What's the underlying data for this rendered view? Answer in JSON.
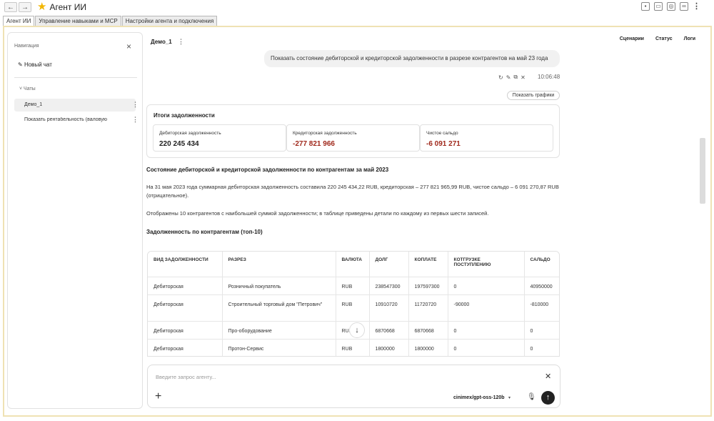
{
  "window": {
    "back_label": "←",
    "forward_label": "→",
    "title": "Агент ИИ",
    "tools": [
      "save-icon",
      "print-icon",
      "preview-icon",
      "link-icon",
      "more-icon"
    ]
  },
  "tabs": [
    {
      "label": "Агент ИИ",
      "active": true
    },
    {
      "label": "Управление навыками и MCP",
      "active": false
    },
    {
      "label": "Настройки агента и подключения",
      "active": false
    }
  ],
  "sidebar": {
    "title": "Навигация",
    "close": "×",
    "new_chat": "Новый чат",
    "chats_header": "Чаты",
    "chats": [
      {
        "label": "Демо_1",
        "selected": true
      },
      {
        "label": "Показать рентабельность (валовую",
        "selected": false
      }
    ]
  },
  "header": {
    "chat_name": "Демо_1",
    "links": [
      "Сценарии",
      "Статус",
      "Логи"
    ]
  },
  "user_message": {
    "text": "Показать состояние дебиторской и кредиторской задолженности в разрезе контрагентов на май 23 года",
    "time": "10:06:48"
  },
  "show_charts_label": "Показать графики",
  "summary": {
    "title": "Итоги задолженности",
    "kpis": [
      {
        "label": "Дебиторская задолженность",
        "value": "220 245 434",
        "negative": false
      },
      {
        "label": "Кредиторская задолженность",
        "value": "-277 821 966",
        "negative": true
      },
      {
        "label": "Чистое сальдо",
        "value": "-6 091 271",
        "negative": true
      }
    ]
  },
  "answer": {
    "heading": "Состояние дебиторской и кредиторской задолженности по контрагентам за май 2023",
    "para1": "На 31 мая 2023 года суммарная дебиторская задолженность составила 220 245 434,22 RUB, кредиторская – 277 821 965,99 RUB, чистое сальдо – 6 091 270,87 RUB (отрицательное).",
    "para2": "Отображены 10 контрагентов с наибольшей суммой задолженности; в таблице приведены детали по каждому из первых шести записей.",
    "table_heading": "Задолженность по контрагентам (топ-10)"
  },
  "table": {
    "headers": [
      "ВИД ЗАДОЛЖЕННОСТИ",
      "РАЗРЕЗ",
      "ВАЛЮТА",
      "ДОЛГ",
      "КОПЛАТЕ",
      "КОТГРУЗКЕ ПОСТУПЛЕНИЮ",
      "САЛЬДО"
    ],
    "rows": [
      [
        "Дебиторская",
        "Розничный покупатель",
        "RUB",
        "238547300",
        "197597300",
        "0",
        "40950000"
      ],
      [
        "Дебиторская",
        "Строительный торговый дом \"Петрович\"",
        "RUB",
        "10910720",
        "11720720",
        "-90000",
        "-810000"
      ],
      [
        "Дебиторская",
        "Про-оборудование",
        "RUB",
        "6870668",
        "6870668",
        "0",
        "0"
      ],
      [
        "Дебиторская",
        "Протон-Сервис",
        "RUB",
        "1800000",
        "1800000",
        "0",
        "0"
      ],
      [
        "",
        "",
        "",
        "",
        "",
        "",
        ""
      ]
    ]
  },
  "input": {
    "placeholder": "Введите запрос агенту...",
    "model": "cinimex/gpt-oss-120b"
  }
}
